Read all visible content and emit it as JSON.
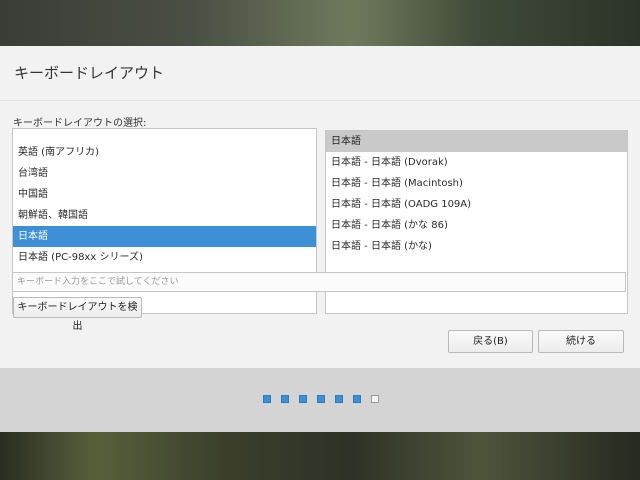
{
  "dialog": {
    "title": "キーボードレイアウト",
    "select_label": "キーボードレイアウトの選択:",
    "layouts": [
      "英語 (南アフリカ)",
      "台湾語",
      "中国語",
      "朝鮮語、韓国語",
      "日本語",
      "日本語 (PC-98xx シリーズ)"
    ],
    "selected_layout": "日本語",
    "variants": [
      "日本語",
      "日本語 - 日本語 (Dvorak)",
      "日本語 - 日本語 (Macintosh)",
      "日本語 - 日本語 (OADG 109A)",
      "日本語 - 日本語 (かな 86)",
      "日本語 - 日本語 (かな)"
    ],
    "selected_variant": "日本語",
    "try_placeholder": "キーボード入力をここで試してください",
    "detect_button": "キーボードレイアウトを検出",
    "back_button": "戻る(B)",
    "next_button": "続ける"
  },
  "progress": {
    "total_steps": 7,
    "completed_steps": 6
  },
  "colors": {
    "accent": "#3e90d6",
    "header_row": "#c9c9c9",
    "dialog_bg": "#f2f2f2",
    "footer_bg": "#d4d4d4"
  }
}
